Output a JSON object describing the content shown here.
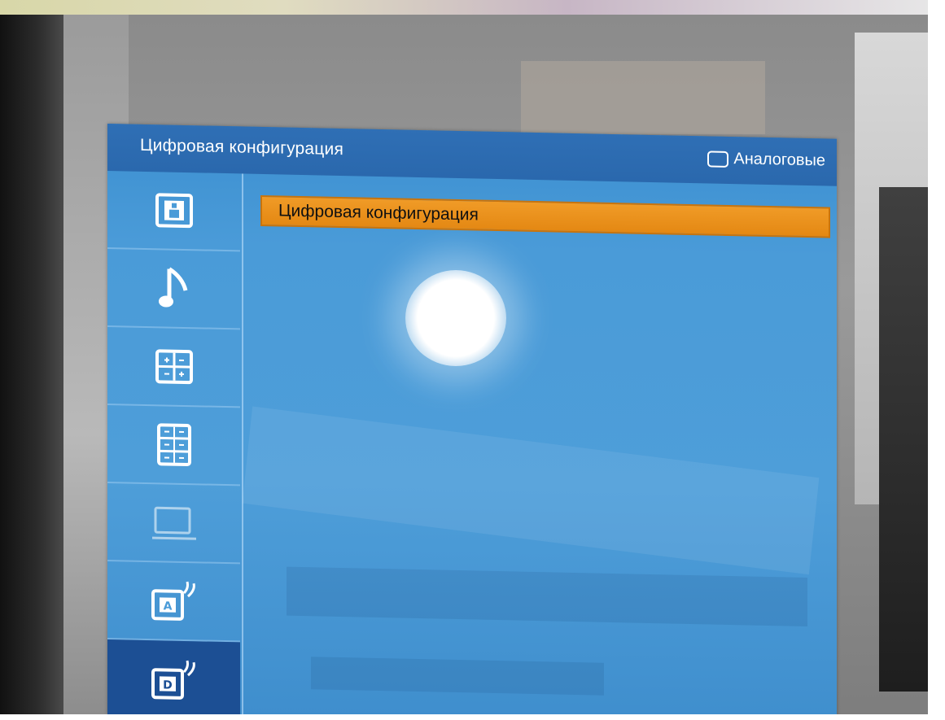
{
  "osd": {
    "title": "Цифровая конфигурация",
    "analog_label": "Аналоговые",
    "selected_item": "Цифровая конфигурация",
    "sidebar": [
      {
        "icon": "picture-icon",
        "active": false
      },
      {
        "icon": "music-note-icon",
        "active": false
      },
      {
        "icon": "grid-arrows-icon",
        "active": false
      },
      {
        "icon": "grid-list-icon",
        "active": false
      },
      {
        "icon": "screen-icon",
        "active": false
      },
      {
        "icon": "analog-antenna-icon",
        "letter": "A",
        "active": false
      },
      {
        "icon": "digital-antenna-icon",
        "letter": "D",
        "active": true
      }
    ]
  },
  "colors": {
    "panel": "#4a9bd8",
    "header": "#2f6fb5",
    "highlight": "#e48813",
    "sidebar_active": "#1c4f94"
  }
}
